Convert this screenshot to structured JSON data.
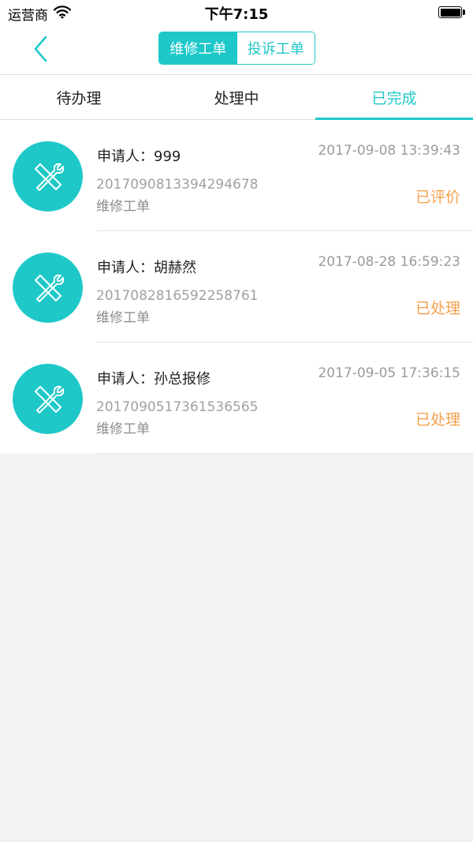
{
  "status_bar": {
    "carrier": "运营商",
    "time": "下午7:15"
  },
  "nav": {
    "segments": [
      {
        "label": "维修工单",
        "active": true
      },
      {
        "label": "投诉工单",
        "active": false
      }
    ]
  },
  "tabs": [
    {
      "label": "待办理",
      "active": false
    },
    {
      "label": "处理中",
      "active": false
    },
    {
      "label": "已完成",
      "active": true
    }
  ],
  "orders": [
    {
      "applicant": "申请人：999",
      "datetime": "2017-09-08 13:39:43",
      "order_no": "2017090813394294678",
      "type": "维修工单",
      "status": "已评价",
      "icon": "tools-icon"
    },
    {
      "applicant": "申请人：胡赫然",
      "datetime": "2017-08-28 16:59:23",
      "order_no": "2017082816592258761",
      "type": "维修工单",
      "status": "已处理",
      "icon": "tools-icon"
    },
    {
      "applicant": "申请人：孙总报修",
      "datetime": "2017-09-05 17:36:15",
      "order_no": "2017090517361536565",
      "type": "维修工单",
      "status": "已处理",
      "icon": "tools-icon"
    }
  ],
  "colors": {
    "accent": "#1ec8c8",
    "status": "#f5a04a",
    "background": "#f2f2f2"
  }
}
